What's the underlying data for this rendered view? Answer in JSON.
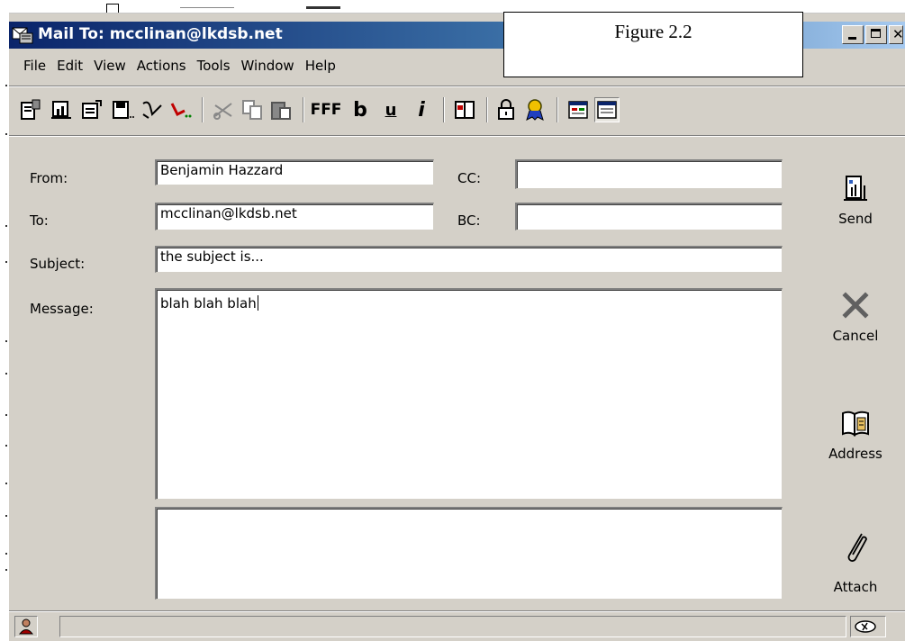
{
  "window": {
    "title": "Mail To: mcclinan@lkdsb.net",
    "icon": "mail-app-icon",
    "controls": [
      "minimize",
      "maximize",
      "close"
    ]
  },
  "figure_label": "Figure 2.2",
  "menu": [
    "File",
    "Edit",
    "View",
    "Actions",
    "Tools",
    "Window",
    "Help"
  ],
  "toolbar": {
    "icons": [
      "new-message-icon",
      "chart-icon",
      "properties-icon",
      "save-icon",
      "spell-check-icon",
      "forward-icon",
      "cut-icon",
      "copy-icon",
      "paste-icon",
      "font-icon",
      "bold-icon",
      "underline-icon",
      "italic-icon",
      "book-icon",
      "lock-icon",
      "ribbon-icon",
      "layout-icon-1",
      "layout-icon-2"
    ],
    "font_glyph": "FFF",
    "bold_glyph": "b",
    "underline_glyph": "u",
    "italic_glyph": "i"
  },
  "form": {
    "from_label": "From:",
    "from_value": "Benjamin Hazzard",
    "to_label": "To:",
    "to_value": "mcclinan@lkdsb.net",
    "cc_label": "CC:",
    "cc_value": "",
    "bc_label": "BC:",
    "bc_value": "",
    "subject_label": "Subject:",
    "subject_value": "the subject is...",
    "message_label": "Message:",
    "message_value": "blah blah blah",
    "attachments_value": ""
  },
  "actions": {
    "send_label": "Send",
    "cancel_label": "Cancel",
    "address_label": "Address",
    "attach_label": "Attach"
  },
  "status": {
    "text": ""
  }
}
